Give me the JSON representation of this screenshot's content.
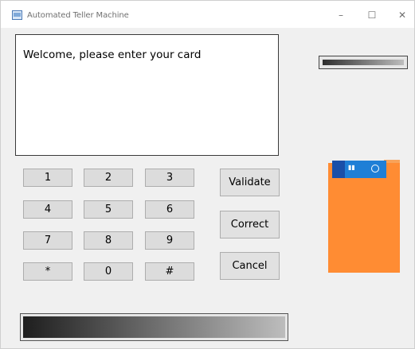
{
  "window": {
    "title": "Automated Teller Machine",
    "controls": {
      "minimize": "–",
      "maximize": "☐",
      "close": "✕"
    }
  },
  "screen": {
    "message": "Welcome, please enter your card"
  },
  "keypad": {
    "keys": [
      "1",
      "2",
      "3",
      "4",
      "5",
      "6",
      "7",
      "8",
      "9",
      "*",
      "0",
      "#"
    ]
  },
  "actions": {
    "validate": "Validate",
    "correct": "Correct",
    "cancel": "Cancel"
  },
  "card": {
    "icon": "credit-card-icon",
    "pocket_color": "#ff8c33",
    "card_color": "#1f7fd6"
  },
  "progress": {
    "value": 1.0
  },
  "card_slot": {
    "value": 1.0
  }
}
